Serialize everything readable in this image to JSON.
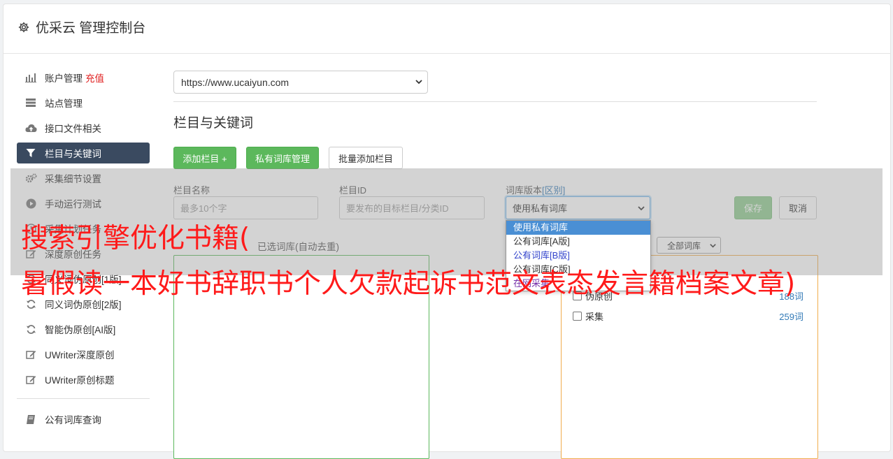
{
  "header": {
    "title": "优采云 管理控制台",
    "icon": "gear-icon"
  },
  "sidebar": {
    "items": [
      {
        "label": "账户管理",
        "icon": "bar-chart-icon",
        "extra": "充值"
      },
      {
        "label": "站点管理",
        "icon": "server-icon"
      },
      {
        "label": "接口文件相关",
        "icon": "cloud-upload-icon"
      },
      {
        "label": "栏目与关键词",
        "icon": "filter-icon",
        "active": true
      },
      {
        "label": "采集细节设置",
        "icon": "gears-icon"
      },
      {
        "label": "手动运行测试",
        "icon": "play-circle-icon"
      },
      {
        "label": "采集计划任务",
        "icon": "clock-icon"
      },
      {
        "label": "深度原创任务",
        "icon": "edit-icon"
      },
      {
        "label": "同义词伪原创[1版]",
        "icon": "refresh-icon"
      },
      {
        "label": "同义词伪原创[2版]",
        "icon": "refresh-icon"
      },
      {
        "label": "智能伪原创[AI版]",
        "icon": "refresh-icon"
      },
      {
        "label": "UWriter深度原创",
        "icon": "edit-icon"
      },
      {
        "label": "UWriter原创标题",
        "icon": "edit-icon"
      }
    ],
    "bottom_items": [
      {
        "label": "公有词库查询",
        "icon": "book-icon"
      }
    ]
  },
  "main": {
    "site_select": {
      "value": "https://www.ucaiyun.com"
    },
    "section_title": "栏目与关键词",
    "buttons": {
      "add_column": "添加栏目 +",
      "private_lib": "私有词库管理",
      "batch_add": "批量添加栏目"
    },
    "form": {
      "column_name_label": "栏目名称",
      "column_name_placeholder": "最多10个字",
      "column_id_label": "栏目ID",
      "column_id_placeholder": "要发布的目标栏目/分类ID",
      "lib_version_label": "词库版本",
      "lib_version_link": "[区别]",
      "lib_version_value": "使用私有词库",
      "save": "保存",
      "cancel": "取消"
    },
    "dropdown_options": [
      "使用私有词库",
      "公有词库[A版]",
      "公有词库[B版]",
      "公有词库[C版]",
      "在网采集"
    ],
    "selected_label": "已选词库(自动去重)",
    "filter_select": "全部词库",
    "library_items": [
      {
        "name": "伪原创",
        "count": "188词"
      },
      {
        "name": "采集",
        "count": "259词"
      }
    ]
  },
  "watermark": {
    "line1": "搜索引擎优化书籍(",
    "line2": "暑假读一本好书辞职书个人欠款起诉书范文表态发言籍档案文章)"
  },
  "colors": {
    "accent_dark": "#3a4a60",
    "green": "#5cb85c",
    "orange": "#f0ad4e",
    "red_text": "#e02020",
    "link": "#337ab7"
  }
}
